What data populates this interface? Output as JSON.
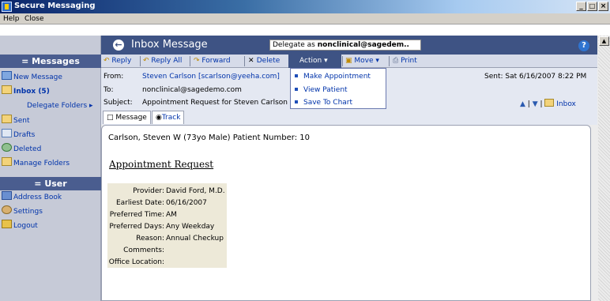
{
  "window": {
    "title": "Secure Messaging",
    "min": "_",
    "restore": "□",
    "close": "×"
  },
  "menubar": {
    "items": [
      "Help",
      "Close"
    ]
  },
  "header": {
    "back_icon": "back-arrow-icon",
    "title": "Inbox Message",
    "delegate_label": "Delegate as",
    "delegate_value": "nonclinical@sagedem..",
    "help": "?"
  },
  "sidebar": {
    "messages_heading": "= Messages",
    "items": [
      {
        "label": "New Message",
        "icon": "new-message-icon"
      },
      {
        "label": "Inbox (5)",
        "icon": "inbox-icon"
      },
      {
        "label": "Delegate Folders ▸",
        "icon": ""
      },
      {
        "label": "Sent",
        "icon": "sent-folder-icon"
      },
      {
        "label": "Drafts",
        "icon": "drafts-icon"
      },
      {
        "label": "Deleted",
        "icon": "deleted-icon"
      },
      {
        "label": "Manage Folders",
        "icon": "folder-icon"
      }
    ],
    "user_heading": "= User",
    "user_items": [
      {
        "label": "Address Book",
        "icon": "address-book-icon"
      },
      {
        "label": "Settings",
        "icon": "settings-icon"
      },
      {
        "label": "Logout",
        "icon": "logout-key-icon"
      }
    ]
  },
  "toolbar": {
    "reply": "Reply",
    "reply_all": "Reply All",
    "forward": "Forward",
    "delete": "Delete",
    "action": "Action",
    "move": "Move",
    "print": "Print"
  },
  "action_menu": [
    "Make Appointment",
    "View Patient",
    "Save To Chart"
  ],
  "message": {
    "from_label": "From:",
    "from": "Steven Carlson [scarlson@yeeha.com]",
    "to_label": "To:",
    "to": "nonclinical@sagedemo.com",
    "subject_label": "Subject:",
    "subject": "Appointment Request for Steven Carlson",
    "sent": "Sent: Sat 6/16/2007 8:22 PM",
    "folder": "Inbox"
  },
  "tabs": {
    "message": "Message",
    "track": "Track"
  },
  "body": {
    "patient_line": "Carlson, Steven W   (73yo Male)   Patient Number: 10",
    "heading": "Appointment Request",
    "rows": [
      {
        "k": "Provider:",
        "v": "David Ford, M.D."
      },
      {
        "k": "Earliest Date:",
        "v": "06/16/2007"
      },
      {
        "k": "Preferred Time:",
        "v": "AM"
      },
      {
        "k": "Preferred Days:",
        "v": "Any Weekday"
      },
      {
        "k": "Reason:",
        "v": "Annual Checkup"
      },
      {
        "k": "Comments:",
        "v": ""
      },
      {
        "k": "Office Location:",
        "v": ""
      }
    ]
  },
  "colors": {
    "nav_dark": "#3e5384",
    "link": "#0033aa",
    "panel": "#c6cad7",
    "table_bg": "#ede9d8"
  }
}
